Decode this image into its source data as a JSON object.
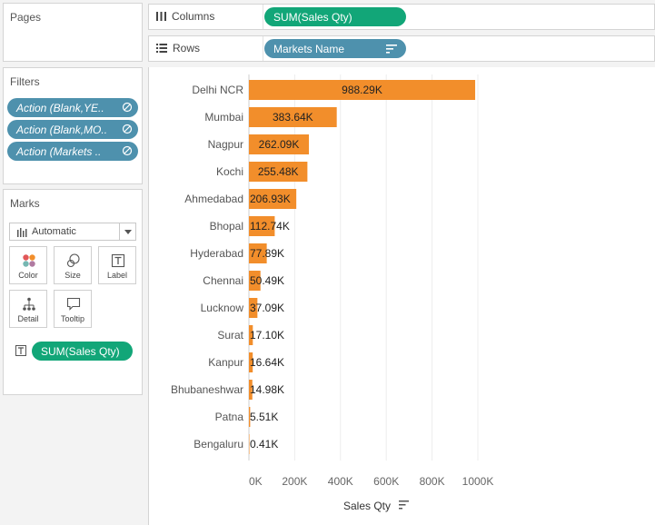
{
  "panels": {
    "pages_title": "Pages",
    "filters_title": "Filters",
    "marks_title": "Marks"
  },
  "filters": [
    "Action (Blank,YE..",
    "Action (Blank,MO..",
    "Action (Markets .."
  ],
  "marks": {
    "type": "Automatic",
    "buttons": [
      "Color",
      "Size",
      "Label",
      "Detail",
      "Tooltip"
    ],
    "label_pill": "SUM(Sales Qty)"
  },
  "shelves": {
    "columns_label": "Columns",
    "columns_pill": "SUM(Sales Qty)",
    "rows_label": "Rows",
    "rows_pill": "Markets Name"
  },
  "colors": {
    "bar": "#f28e2b",
    "green_pill": "#12a678",
    "blue_pill": "#4e91ad"
  },
  "chart_data": {
    "type": "bar",
    "orientation": "horizontal",
    "categories": [
      "Delhi NCR",
      "Mumbai",
      "Nagpur",
      "Kochi",
      "Ahmedabad",
      "Bhopal",
      "Hyderabad",
      "Chennai",
      "Lucknow",
      "Surat",
      "Kanpur",
      "Bhubaneshwar",
      "Patna",
      "Bengaluru"
    ],
    "values": [
      988290,
      383640,
      262090,
      255480,
      206930,
      112740,
      77890,
      50490,
      37090,
      17100,
      16640,
      14980,
      5510,
      410
    ],
    "labels": [
      "988.29K",
      "383.64K",
      "262.09K",
      "255.48K",
      "206.93K",
      "112.74K",
      "77.89K",
      "50.49K",
      "37.09K",
      "17.10K",
      "16.64K",
      "14.98K",
      "5.51K",
      "0.41K"
    ],
    "xlabel": "Sales Qty",
    "xticks": [
      0,
      200000,
      400000,
      600000,
      800000,
      1000000
    ],
    "xtick_labels": [
      "0K",
      "200K",
      "400K",
      "600K",
      "800K",
      "1000K"
    ],
    "xlim": [
      0,
      1000000
    ],
    "grid": true
  }
}
